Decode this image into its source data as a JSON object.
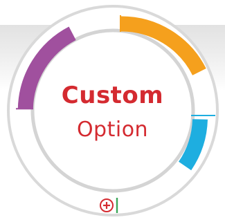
{
  "dial": {
    "title": "Custom",
    "subtitle": "Option"
  },
  "segments": [
    {
      "name": "purple-segment",
      "color": "#a0509e"
    },
    {
      "name": "orange-segment",
      "color": "#f5a01d"
    },
    {
      "name": "blue-segment",
      "color": "#1eaee0"
    }
  ],
  "add_control": {
    "icon": "plus-circle-icon",
    "icon_color": "#d42a30",
    "marker_color": "#3aa658"
  },
  "colors": {
    "title": "#d42a30",
    "ring": "#dadada",
    "backdrop": "#e6e6e6"
  }
}
